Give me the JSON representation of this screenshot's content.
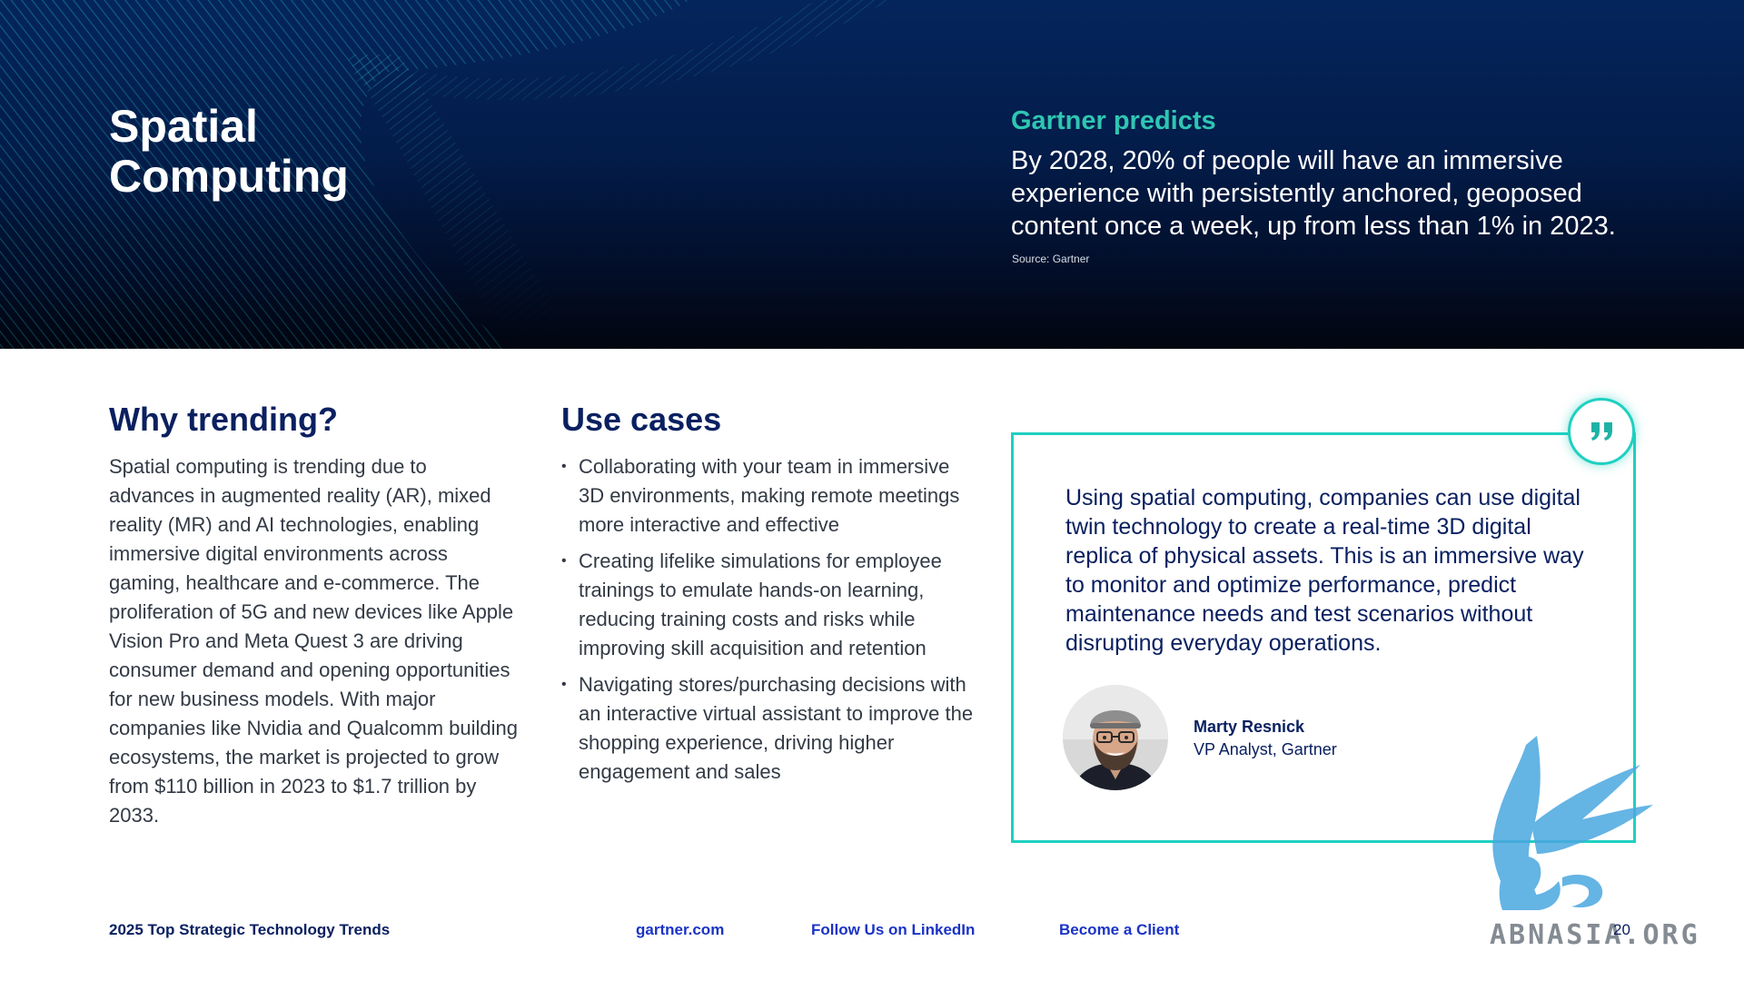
{
  "hero": {
    "title_lines": [
      "Spatial",
      "Computing"
    ],
    "prediction_label": "Gartner predicts",
    "prediction_text": "By 2028, 20% of people will have an immersive experience with persistently anchored, geoposed content once a week, up from less than 1% in 2023.",
    "source": "Source: Gartner"
  },
  "why": {
    "heading": "Why trending?",
    "body": "Spatial computing is trending due to advances in augmented reality (AR), mixed reality (MR) and AI technologies, enabling immersive digital environments across gaming, healthcare and e-commerce. The proliferation of 5G and new devices like Apple Vision Pro and Meta Quest 3 are driving consumer demand and opening opportunities for new business models. With major companies like Nvidia and Qualcomm building ecosystems, the market is projected to grow from $110 billion in 2023 to $1.7 trillion by 2033."
  },
  "uses": {
    "heading": "Use cases",
    "items": [
      "Collaborating with your team in immersive 3D environments, making remote meetings more interactive and effective",
      "Creating lifelike simulations for employee trainings to emulate hands-on learning, reducing training costs and risks while improving skill acquisition and retention",
      "Navigating stores/purchasing decisions with an interactive virtual assistant to improve the shopping experience, driving higher engagement and sales"
    ]
  },
  "quote": {
    "icon": "quote-mark-icon",
    "text": "Using spatial computing, companies can use digital twin technology to create a real-time 3D digital replica of physical assets. This is an immersive way to monitor and optimize performance, predict maintenance needs and test scenarios without disrupting everyday operations.",
    "name": "Marty Resnick",
    "role": "VP Analyst, Gartner"
  },
  "footer": {
    "report_title": "2025 Top Strategic Technology Trends",
    "site_link": "gartner.com",
    "linkedin_link": "Follow Us on LinkedIn",
    "client_link": "Become a Client",
    "page_number": "20"
  },
  "watermark": {
    "text": "ABNASIA.ORG"
  },
  "colors": {
    "navy": "#0a2060",
    "teal": "#2fc6b2",
    "card_border": "#1fd0c0",
    "link_blue": "#1b33c6",
    "watermark_blue": "#4aa8e0"
  }
}
